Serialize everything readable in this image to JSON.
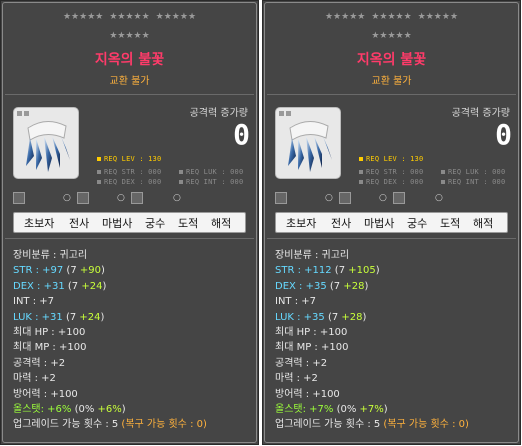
{
  "tooltips": [
    {
      "title": "지옥의 불꽃",
      "subtitle": "교환 불가",
      "atk_label": "공격력 증가량",
      "atk_value": "0",
      "req_lev": "REQ LEV : 130",
      "req_str": "REQ STR : 000",
      "req_luk": "REQ LUK : 000",
      "req_dex": "REQ DEX : 000",
      "req_int": "REQ INT : 000",
      "small_icons": [
        "○",
        "○",
        "○"
      ],
      "jobs": [
        "초보자",
        "전사",
        "마법사",
        "궁수",
        "도적",
        "해적"
      ],
      "lines": [
        {
          "a": "장비분류 : 귀고리"
        },
        {
          "a": "STR : +97",
          "b": " (7 ",
          "c": "+90",
          "d": ")"
        },
        {
          "a": "DEX : +31",
          "b": " (7 ",
          "c": "+24",
          "d": ")"
        },
        {
          "a": "INT : +7"
        },
        {
          "a": "LUK : +31",
          "b": " (7 ",
          "c": "+24",
          "d": ")"
        },
        {
          "a": "최대 HP : +100"
        },
        {
          "a": "최대 MP : +100"
        },
        {
          "a": "공격력 : +2"
        },
        {
          "a": "마력 : +2"
        },
        {
          "a": "방어력 : +100"
        },
        {
          "a": "올스탯: +6%",
          "b": " (0% ",
          "c": "+6%",
          "d": ")"
        },
        {
          "a": "업그레이드 가능 횟수 : 5",
          "b": " (복구 가능 횟수 : 0)"
        }
      ]
    },
    {
      "title": "지옥의 불꽃",
      "subtitle": "교환 불가",
      "atk_label": "공격력 증가량",
      "atk_value": "0",
      "req_lev": "REQ LEV : 130",
      "req_str": "REQ STR : 000",
      "req_luk": "REQ LUK : 000",
      "req_dex": "REQ DEX : 000",
      "req_int": "REQ INT : 000",
      "small_icons": [
        "○",
        "○",
        "○"
      ],
      "jobs": [
        "초보자",
        "전사",
        "마법사",
        "궁수",
        "도적",
        "해적"
      ],
      "lines": [
        {
          "a": "장비분류 : 귀고리"
        },
        {
          "a": "STR : +112",
          "b": " (7 ",
          "c": "+105",
          "d": ")"
        },
        {
          "a": "DEX : +35",
          "b": " (7 ",
          "c": "+28",
          "d": ")"
        },
        {
          "a": "INT : +7"
        },
        {
          "a": "LUK : +35",
          "b": " (7 ",
          "c": "+28",
          "d": ")"
        },
        {
          "a": "최대 HP : +100"
        },
        {
          "a": "최대 MP : +100"
        },
        {
          "a": "공격력 : +2"
        },
        {
          "a": "마력 : +2"
        },
        {
          "a": "방어력 : +100"
        },
        {
          "a": "올스탯: +7%",
          "b": " (0% ",
          "c": "+7%",
          "d": ")"
        },
        {
          "a": "업그레이드 가능 횟수 : 5",
          "b": " (복구 가능 횟수 : 0)"
        }
      ]
    }
  ],
  "colors": {
    "title": "#ff3b6a",
    "subtitle": "#ffb23d",
    "stat_cyan": "#66d9ff",
    "bonus_lime": "#c8ff3a",
    "req_on": "#ffcc00",
    "panel_bg": "#454545"
  },
  "icons": {
    "item": "claw-gauntlet-icon",
    "star": "star-icon"
  }
}
